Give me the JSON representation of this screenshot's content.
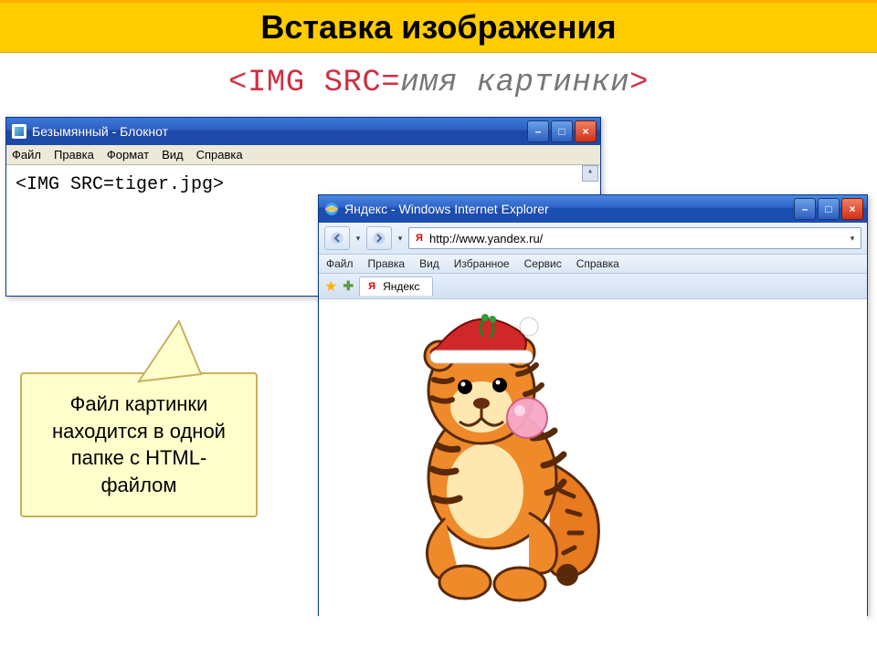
{
  "header": {
    "title": "Вставка изображения"
  },
  "code_example": {
    "tag_open": "<",
    "tag": "IMG SRC",
    "eq": "=",
    "param": "имя картинки",
    "tag_close": ">"
  },
  "notepad": {
    "title": "Безымянный - Блокнот",
    "menu": [
      "Файл",
      "Правка",
      "Формат",
      "Вид",
      "Справка"
    ],
    "content": "<IMG SRC=tiger.jpg>"
  },
  "ie": {
    "title": "Яндекс - Windows Internet Explorer",
    "address": "http://www.yandex.ru/",
    "menu": [
      "Файл",
      "Правка",
      "Вид",
      "Избранное",
      "Сервис",
      "Справка"
    ],
    "tab_label": "Яндекс",
    "yandex_glyph": "Я"
  },
  "callout": {
    "text": "Файл картинки находится в одной папке с HTML-файлом"
  },
  "icons": {
    "min": "–",
    "max": "□",
    "close": "×",
    "up": "▴"
  }
}
